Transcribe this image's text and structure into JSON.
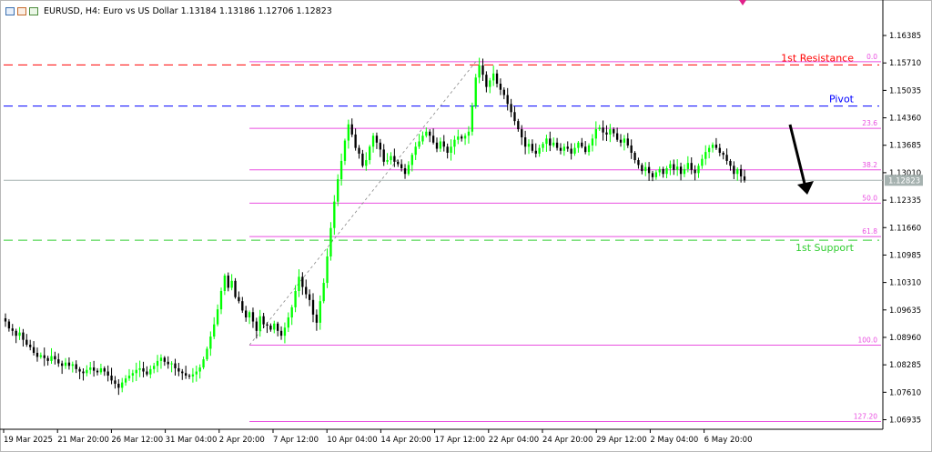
{
  "header": {
    "symbol_line": "EURUSD, H4:  Euro vs US Dollar  1.13184 1.13186 1.12706 1.12823",
    "icons": [
      "chart-window-icon",
      "data-window-icon",
      "indicator-window-icon"
    ]
  },
  "colors": {
    "bull": "#00ff00",
    "bear": "#000000",
    "resistance": "#ff0000",
    "pivot": "#0000ff",
    "support": "#32cd32",
    "fibo": "#e94fe0",
    "current_price_line": "#a6b2b0",
    "axis_text": "#000000",
    "price_box_bg": "#a6b2b0",
    "arrow": "#000000",
    "top_marker": "#e0208a"
  },
  "chart_data": {
    "type": "candlestick",
    "title": "EURUSD, H4:  Euro vs US Dollar  1.13184 1.13186 1.12706 1.12823",
    "ylim": [
      1.067,
      1.169
    ],
    "y_ticks": [
      "1.16385",
      "1.15710",
      "1.15035",
      "1.14360",
      "1.13685",
      "1.13010",
      "1.12335",
      "1.11660",
      "1.10985",
      "1.10310",
      "1.09635",
      "1.08960",
      "1.08285",
      "1.07610",
      "1.06935"
    ],
    "x_ticks": [
      "19 Mar 2025",
      "21 Mar 20:00",
      "26 Mar 12:00",
      "31 Mar 04:00",
      "2 Apr 20:00",
      "7 Apr 12:00",
      "10 Apr 04:00",
      "14 Apr 20:00",
      "17 Apr 12:00",
      "22 Apr 04:00",
      "24 Apr 20:00",
      "29 Apr 12:00",
      "2 May 04:00",
      "6 May 20:00"
    ],
    "current_price": "1.12823",
    "close_series": [
      1.0935,
      1.0918,
      1.0912,
      1.09,
      1.0908,
      1.089,
      1.0878,
      1.0872,
      1.0858,
      1.0848,
      1.0852,
      1.0845,
      1.0838,
      1.085,
      1.0842,
      1.0832,
      1.0826,
      1.0834,
      1.0826,
      1.083,
      1.0818,
      1.0812,
      1.0808,
      1.0816,
      1.0822,
      1.0814,
      1.081,
      1.082,
      1.0812,
      1.0802,
      1.079,
      1.0782,
      1.0772,
      1.0785,
      1.0795,
      1.0802,
      1.0808,
      1.0816,
      1.082,
      1.0812,
      1.0805,
      1.0818,
      1.0826,
      1.0838,
      1.0846,
      1.0836,
      1.083,
      1.0832,
      1.082,
      1.0812,
      1.0808,
      1.0802,
      1.08,
      1.0805,
      1.0812,
      1.0822,
      1.0842,
      1.0868,
      1.0898,
      1.0928,
      1.0965,
      1.101,
      1.1048,
      1.1018,
      1.1035,
      1.0995,
      1.0985,
      1.0962,
      1.0945,
      1.0958,
      1.0935,
      1.0912,
      1.0948,
      1.0928,
      1.0925,
      1.0915,
      1.093,
      1.0912,
      1.09,
      1.092,
      1.0945,
      1.097,
      1.101,
      1.1045,
      1.102,
      1.1002,
      1.0988,
      1.0952,
      1.0932,
      1.0985,
      1.103,
      1.1095,
      1.1165,
      1.123,
      1.1285,
      1.133,
      1.138,
      1.142,
      1.1395,
      1.1362,
      1.1348,
      1.1318,
      1.1332,
      1.1365,
      1.1392,
      1.1375,
      1.1358,
      1.1328,
      1.1332,
      1.1342,
      1.1328,
      1.1322,
      1.1312,
      1.1298,
      1.132,
      1.1345,
      1.1365,
      1.1378,
      1.1392,
      1.1402,
      1.1392,
      1.1375,
      1.136,
      1.1378,
      1.1365,
      1.135,
      1.1365,
      1.1382,
      1.139,
      1.1385,
      1.1392,
      1.1402,
      1.1465,
      1.1535,
      1.1565,
      1.1542,
      1.1512,
      1.1528,
      1.1545,
      1.152,
      1.1505,
      1.1492,
      1.147,
      1.145,
      1.1428,
      1.1408,
      1.1388,
      1.1365,
      1.1372,
      1.1355,
      1.1348,
      1.1362,
      1.1372,
      1.1385,
      1.1368,
      1.1375,
      1.1362,
      1.1355,
      1.1365,
      1.136,
      1.1348,
      1.1362,
      1.1375,
      1.1365,
      1.1352,
      1.1368,
      1.1385,
      1.1408,
      1.1412,
      1.14,
      1.1395,
      1.1408,
      1.1398,
      1.1382,
      1.1375,
      1.1385,
      1.1368,
      1.135,
      1.1332,
      1.132,
      1.1305,
      1.1315,
      1.13,
      1.129,
      1.1302,
      1.131,
      1.1298,
      1.1312,
      1.1322,
      1.1308,
      1.1316,
      1.1298,
      1.131,
      1.1325,
      1.1308,
      1.13,
      1.1318,
      1.1335,
      1.1352,
      1.1362,
      1.137,
      1.1362,
      1.135,
      1.1345,
      1.133,
      1.1318,
      1.1298,
      1.131,
      1.1292,
      1.1282
    ],
    "levels": [
      {
        "label": "1st Resistance",
        "price": 1.1566,
        "color": "resistance",
        "dash": "10,6"
      },
      {
        "label": "Pivot",
        "price": 1.1465,
        "color": "pivot",
        "dash": "10,6"
      },
      {
        "label": "1st Support",
        "price": 1.1135,
        "color": "support",
        "dash": "10,6"
      }
    ],
    "fibo": {
      "start_index": 69,
      "levels": [
        {
          "label": "0.0",
          "price": 1.1574
        },
        {
          "label": "23.6",
          "price": 1.141
        },
        {
          "label": "38.2",
          "price": 1.1308
        },
        {
          "label": "50.0",
          "price": 1.1226
        },
        {
          "label": "61.8",
          "price": 1.1144
        },
        {
          "label": "100.0",
          "price": 1.0877
        },
        {
          "label": "127.20",
          "price": 1.0689
        }
      ],
      "trend_from": {
        "index": 69,
        "price": 1.0877
      },
      "trend_to": {
        "index": 133,
        "price": 1.1574
      }
    }
  }
}
